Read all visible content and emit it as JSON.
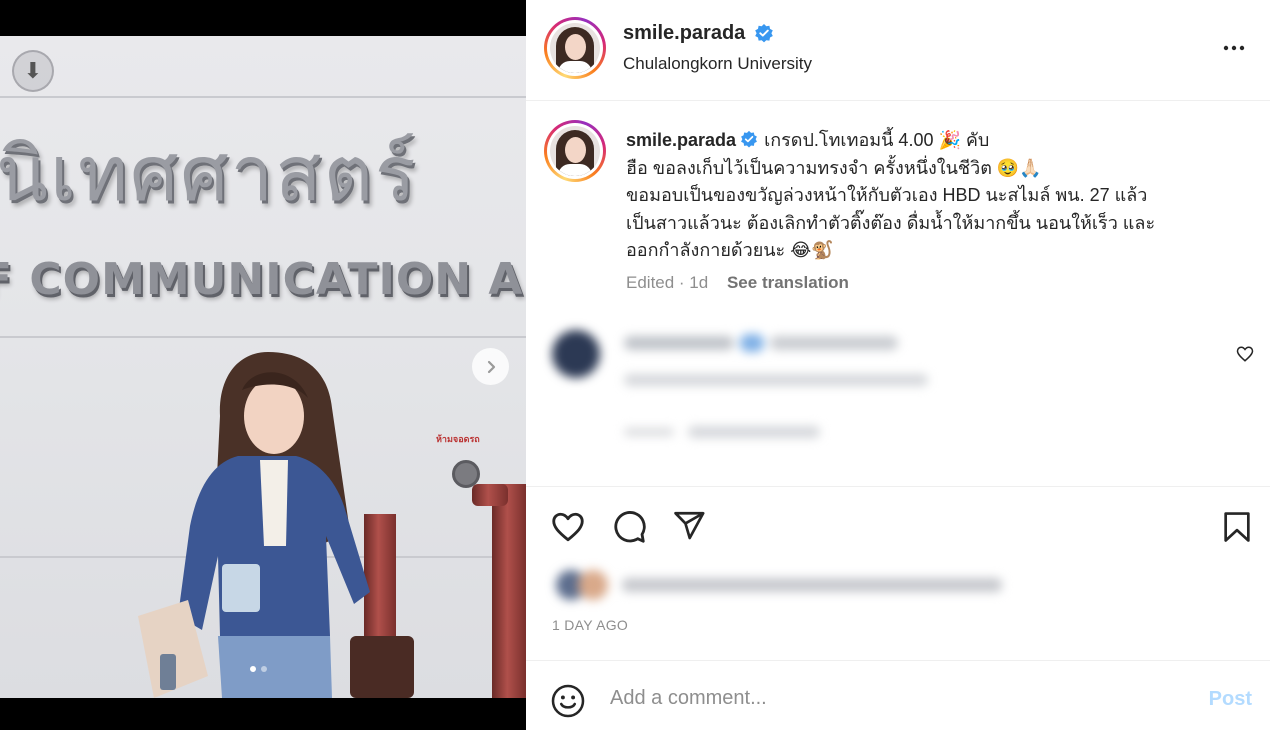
{
  "post": {
    "image_alt": "Woman posing in front of Communication Arts building sign",
    "photo_thai_sign": "นิเทศศาสตร์",
    "photo_eng_sign": "F COMMUNICATION ARTS",
    "photo_plate": "ห้ามจอดรถ",
    "carousel": {
      "current": 1,
      "total": 2
    }
  },
  "header": {
    "username": "smile.parada",
    "location": "Chulalongkorn University",
    "verified": true
  },
  "caption": {
    "username": "smile.parada",
    "lines": [
      "เกรดป.โทเทอมนี้ 4.00 🎉 คับ",
      "ฮือ ขอลงเก็บไว้เป็นความทรงจำ ครั้งหนึ่งในชีวิต 🥹🙏🏻",
      "ขอมอบเป็นของขวัญล่วงหน้าให้กับตัวเอง HBD นะสไมล์ พน. 27 แล้ว",
      "เป็นสาวแล้วนะ ต้องเลิกทำตัวติ๊งต๊อง ดื่มน้ำให้มากขึ้น นอนให้เร็ว และ",
      "ออกกำลังกายด้วยนะ 😂🐒"
    ],
    "edited": "Edited · 1d",
    "see_translation": "See translation"
  },
  "footer": {
    "timestamp": "1 DAY AGO",
    "comment_placeholder": "Add a comment...",
    "post_label": "Post"
  },
  "colors": {
    "verified_blue": "#3897f0",
    "post_disabled": "#b3dbff",
    "meta_gray": "#8e8e8e"
  }
}
